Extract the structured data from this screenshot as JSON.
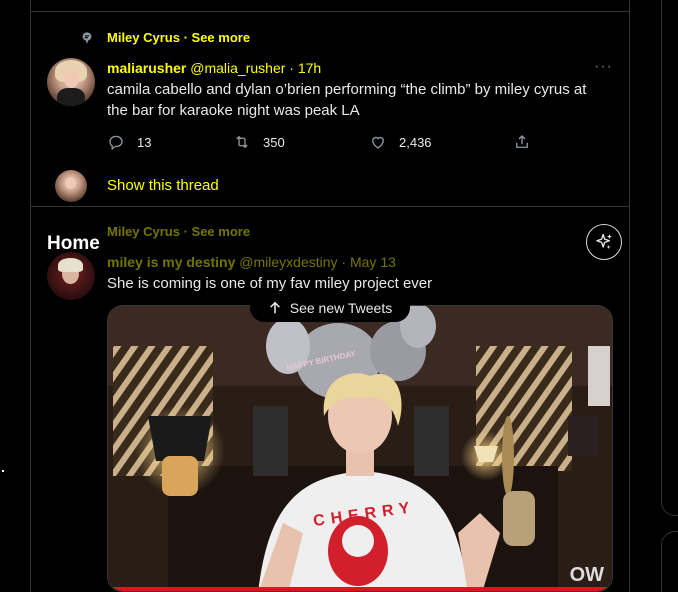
{
  "tweet1": {
    "social_context": "Miley Cyrus · See more",
    "display_name": "maliarusher",
    "handle_time": "@malia_rusher · 17h",
    "text": "camila cabello and dylan o’brien performing “the climb” by miley cyrus at the bar for karaoke night was peak LA",
    "replies": "13",
    "retweets": "350",
    "likes": "2,436",
    "more_icon": "more-horizontal-icon",
    "show_thread": "Show this thread"
  },
  "header": {
    "title": "Home",
    "sparkle_icon": "sparkle-icon"
  },
  "tweet2": {
    "social_context": "Miley Cyrus · See more",
    "display_name": "miley is my destiny",
    "handle_time": "@mileyxdestiny · May 13",
    "text": "She is coming is one of my fav miley project ever"
  },
  "new_tweets_pill": {
    "label": "See new Tweets",
    "icon": "arrow-up-icon"
  },
  "media_overlay": {
    "shirt_text": "CHERRY",
    "balloon_text": "HAPPY BIRTHDAY",
    "corner_logo": "OW"
  },
  "colors": {
    "background": "#000000",
    "accent": "#ffff00",
    "text": "#e7e9ea",
    "border": "#2f3336"
  }
}
